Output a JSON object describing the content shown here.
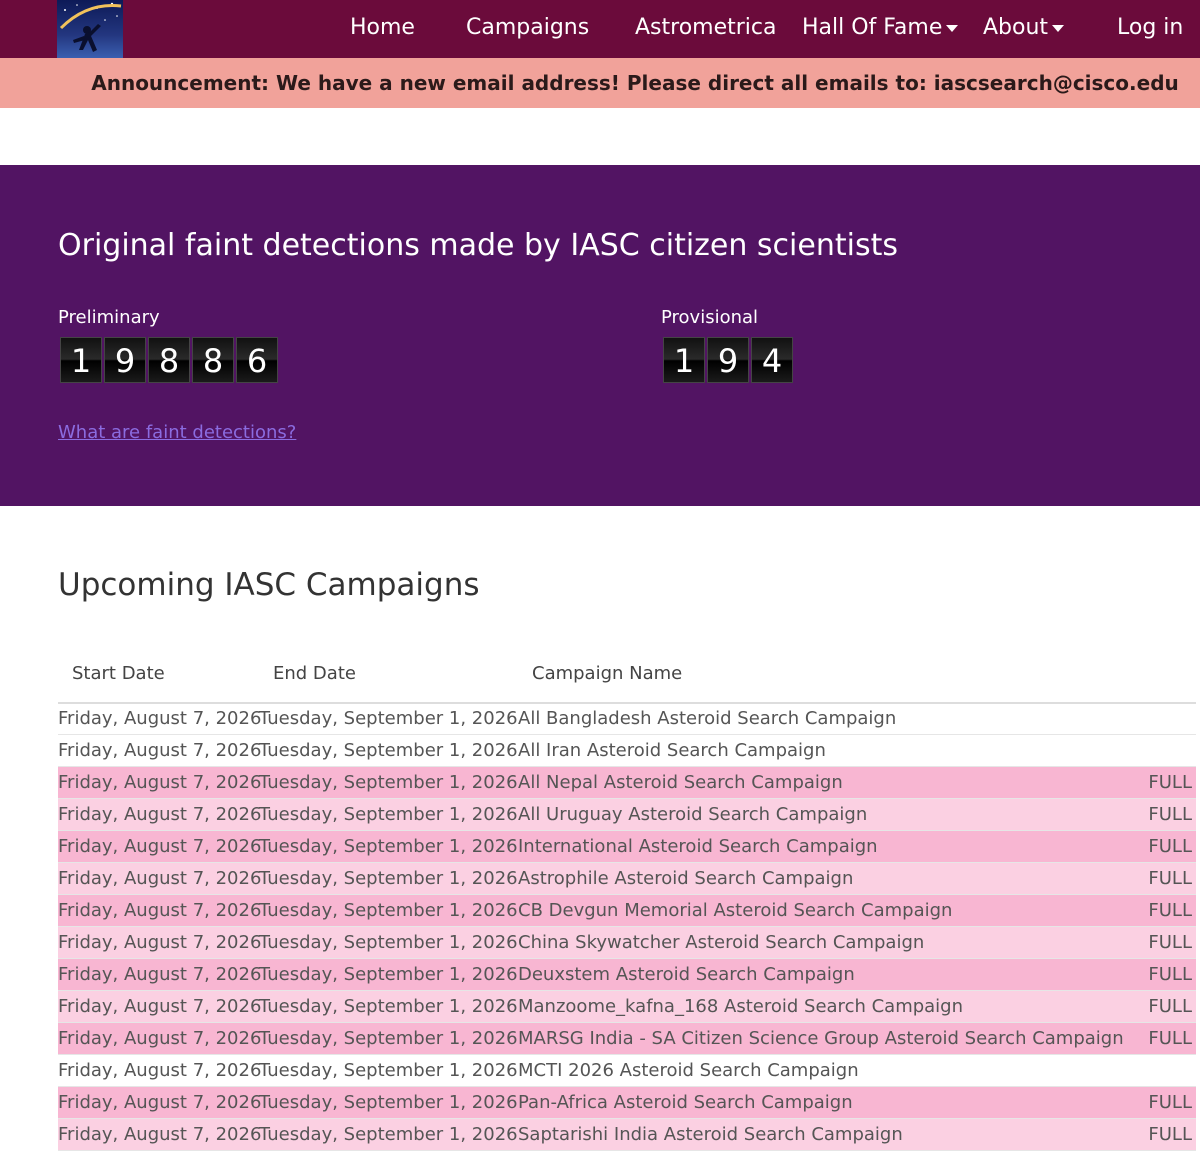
{
  "nav": {
    "items": [
      {
        "label": "Home",
        "dropdown": false
      },
      {
        "label": "Campaigns",
        "dropdown": false
      },
      {
        "label": "Astrometrica",
        "dropdown": false
      },
      {
        "label": "Hall Of Fame",
        "dropdown": true
      },
      {
        "label": "About",
        "dropdown": true
      },
      {
        "label": "Log in",
        "dropdown": false
      }
    ]
  },
  "announcement": "Announcement: We have a new email address! Please direct all emails to: iascsearch@cisco.edu",
  "detections": {
    "title": "Original faint detections made by IASC citizen scientists",
    "preliminary": {
      "label": "Preliminary",
      "digits": [
        "1",
        "9",
        "8",
        "8",
        "6"
      ]
    },
    "provisional": {
      "label": "Provisional",
      "digits": [
        "1",
        "9",
        "4"
      ]
    },
    "link": "What are faint detections?"
  },
  "campaigns": {
    "title": "Upcoming IASC Campaigns",
    "columns": [
      "Start Date",
      "End Date",
      "Campaign Name"
    ],
    "rows": [
      {
        "start": "Friday, August 7, 2026",
        "end": "Tuesday, September 1, 2026",
        "name": "All Bangladesh Asteroid Search Campaign",
        "status": ""
      },
      {
        "start": "Friday, August 7, 2026",
        "end": "Tuesday, September 1, 2026",
        "name": "All Iran Asteroid Search Campaign",
        "status": ""
      },
      {
        "start": "Friday, August 7, 2026",
        "end": "Tuesday, September 1, 2026",
        "name": "All Nepal Asteroid Search Campaign",
        "status": "FULL"
      },
      {
        "start": "Friday, August 7, 2026",
        "end": "Tuesday, September 1, 2026",
        "name": "All Uruguay Asteroid Search Campaign",
        "status": "FULL"
      },
      {
        "start": "Friday, August 7, 2026",
        "end": "Tuesday, September 1, 2026",
        "name": "International Asteroid Search Campaign",
        "status": "FULL"
      },
      {
        "start": "Friday, August 7, 2026",
        "end": "Tuesday, September 1, 2026",
        "name": "Astrophile Asteroid Search Campaign",
        "status": "FULL"
      },
      {
        "start": "Friday, August 7, 2026",
        "end": "Tuesday, September 1, 2026",
        "name": "CB Devgun Memorial Asteroid Search Campaign",
        "status": "FULL"
      },
      {
        "start": "Friday, August 7, 2026",
        "end": "Tuesday, September 1, 2026",
        "name": "China Skywatcher Asteroid Search Campaign",
        "status": "FULL"
      },
      {
        "start": "Friday, August 7, 2026",
        "end": "Tuesday, September 1, 2026",
        "name": "Deuxstem Asteroid Search Campaign",
        "status": "FULL"
      },
      {
        "start": "Friday, August 7, 2026",
        "end": "Tuesday, September 1, 2026",
        "name": "Manzoome_kafna_168 Asteroid Search Campaign",
        "status": "FULL"
      },
      {
        "start": "Friday, August 7, 2026",
        "end": "Tuesday, September 1, 2026",
        "name": "MARSG India - SA Citizen Science Group Asteroid Search Campaign",
        "status": "FULL"
      },
      {
        "start": "Friday, August 7, 2026",
        "end": "Tuesday, September 1, 2026",
        "name": "MCTI 2026 Asteroid Search Campaign",
        "status": ""
      },
      {
        "start": "Friday, August 7, 2026",
        "end": "Tuesday, September 1, 2026",
        "name": "Pan-Africa Asteroid Search Campaign",
        "status": "FULL"
      },
      {
        "start": "Friday, August 7, 2026",
        "end": "Tuesday, September 1, 2026",
        "name": "Saptarishi India Asteroid Search Campaign",
        "status": "FULL"
      }
    ]
  },
  "colors": {
    "navbar": "#6b0b3b",
    "announcement": "#f1a29a",
    "detections_bg": "#521463",
    "row_full_dark": "#f8b6d2",
    "row_full_light": "#fbd0e2"
  }
}
